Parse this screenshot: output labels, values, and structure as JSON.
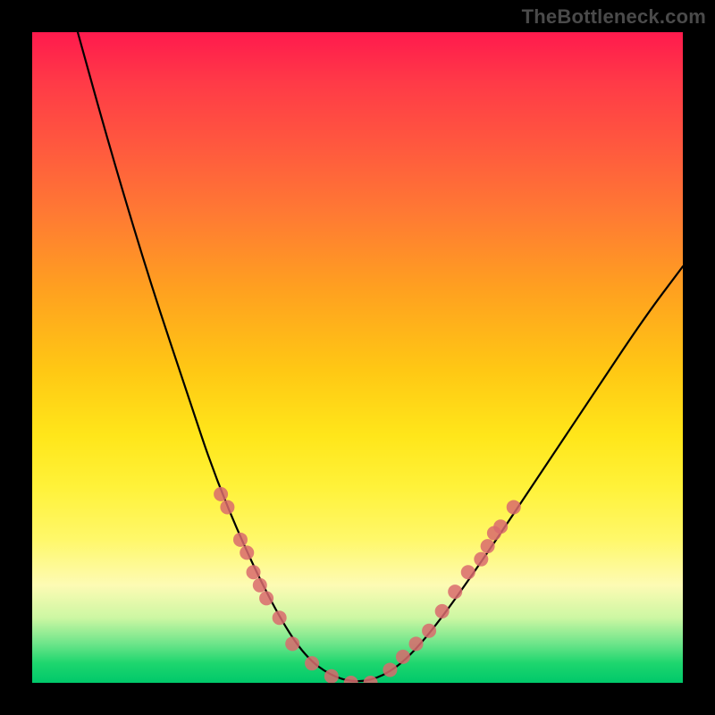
{
  "watermark": "TheBottleneck.com",
  "chart_data": {
    "type": "line",
    "title": "",
    "xlabel": "",
    "ylabel": "",
    "xlim": [
      0,
      100
    ],
    "ylim": [
      0,
      100
    ],
    "grid": false,
    "legend": false,
    "gradient_stops": [
      {
        "pct": 0,
        "color": "#ff1a4d"
      },
      {
        "pct": 18,
        "color": "#ff5a3e"
      },
      {
        "pct": 40,
        "color": "#ffa21f"
      },
      {
        "pct": 62,
        "color": "#ffe61a"
      },
      {
        "pct": 85,
        "color": "#fdfbb4"
      },
      {
        "pct": 100,
        "color": "#00c86a"
      }
    ],
    "series": [
      {
        "name": "bottleneck-curve",
        "values": [
          {
            "x": 7,
            "y": 100
          },
          {
            "x": 12,
            "y": 82
          },
          {
            "x": 18,
            "y": 62
          },
          {
            "x": 24,
            "y": 44
          },
          {
            "x": 28,
            "y": 32
          },
          {
            "x": 33,
            "y": 20
          },
          {
            "x": 38,
            "y": 10
          },
          {
            "x": 42,
            "y": 4
          },
          {
            "x": 46,
            "y": 1
          },
          {
            "x": 50,
            "y": 0
          },
          {
            "x": 54,
            "y": 1
          },
          {
            "x": 58,
            "y": 4
          },
          {
            "x": 63,
            "y": 10
          },
          {
            "x": 70,
            "y": 20
          },
          {
            "x": 78,
            "y": 32
          },
          {
            "x": 86,
            "y": 44
          },
          {
            "x": 94,
            "y": 56
          },
          {
            "x": 100,
            "y": 64
          }
        ]
      },
      {
        "name": "data-markers",
        "type": "scatter",
        "color": "#d96a6d",
        "values": [
          {
            "x": 29,
            "y": 29
          },
          {
            "x": 30,
            "y": 27
          },
          {
            "x": 32,
            "y": 22
          },
          {
            "x": 33,
            "y": 20
          },
          {
            "x": 34,
            "y": 17
          },
          {
            "x": 35,
            "y": 15
          },
          {
            "x": 36,
            "y": 13
          },
          {
            "x": 38,
            "y": 10
          },
          {
            "x": 40,
            "y": 6
          },
          {
            "x": 43,
            "y": 3
          },
          {
            "x": 46,
            "y": 1
          },
          {
            "x": 49,
            "y": 0
          },
          {
            "x": 52,
            "y": 0
          },
          {
            "x": 55,
            "y": 2
          },
          {
            "x": 57,
            "y": 4
          },
          {
            "x": 59,
            "y": 6
          },
          {
            "x": 61,
            "y": 8
          },
          {
            "x": 63,
            "y": 11
          },
          {
            "x": 65,
            "y": 14
          },
          {
            "x": 67,
            "y": 17
          },
          {
            "x": 69,
            "y": 19
          },
          {
            "x": 70,
            "y": 21
          },
          {
            "x": 71,
            "y": 23
          },
          {
            "x": 72,
            "y": 24
          },
          {
            "x": 74,
            "y": 27
          }
        ]
      }
    ]
  }
}
